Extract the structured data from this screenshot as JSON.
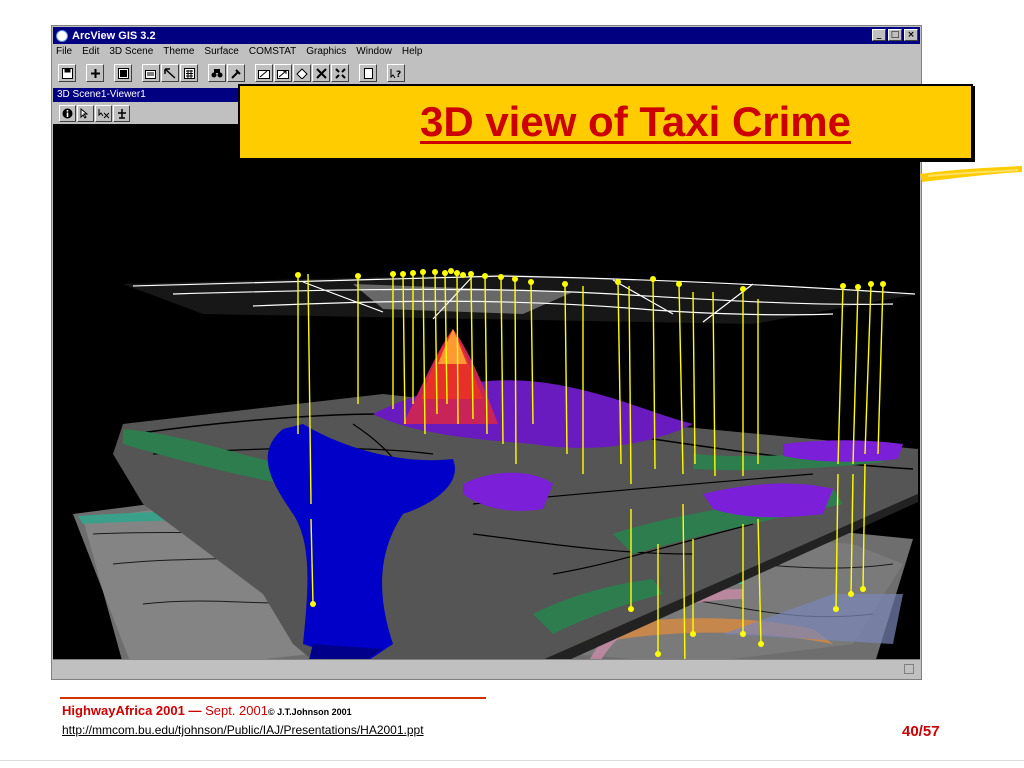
{
  "app": {
    "title": "ArcView GIS 3.2",
    "window_buttons": [
      "_",
      "□",
      "×"
    ],
    "menu": [
      "File",
      "Edit",
      "3D Scene",
      "Theme",
      "Surface",
      "COMSTAT",
      "Graphics",
      "Window",
      "Help"
    ],
    "toolbar_icons": [
      "save-icon",
      "add-theme-icon",
      "table-icon",
      "properties-icon",
      "select-icon",
      "calculator-icon",
      "find-icon",
      "query-icon",
      "zoom-full-extent-icon",
      "zoom-active-themes-icon",
      "zoom-selected-icon",
      "zoom-in-fixed-icon",
      "zoom-out-fixed-icon",
      "layout-icon",
      "help-icon"
    ]
  },
  "viewer": {
    "title": "3D Scene1-Viewer1",
    "tools": [
      "identify-icon",
      "pointer-icon",
      "navigate-icon",
      "fly-icon"
    ]
  },
  "slide": {
    "title": "3D view of Taxi Crime"
  },
  "footer": {
    "event": "HighwayAfrica 2001 —",
    "date": "Sept. 2001",
    "copyright": "© J.T.Johnson 2001",
    "url": "http://mmcom.bu.edu/tjohnson/Public/IAJ/Presentations/HA2001.ppt",
    "page": "40/57"
  },
  "colors": {
    "title_box": "#ffcc00",
    "title_text": "#cc0000",
    "crime_markers": "#ffff00",
    "water": "#0000c8",
    "land": "#505050",
    "parks": "#2e7d4f",
    "hotspot_low": "#7b1fd8",
    "hotspot_high": "#e8302a"
  }
}
